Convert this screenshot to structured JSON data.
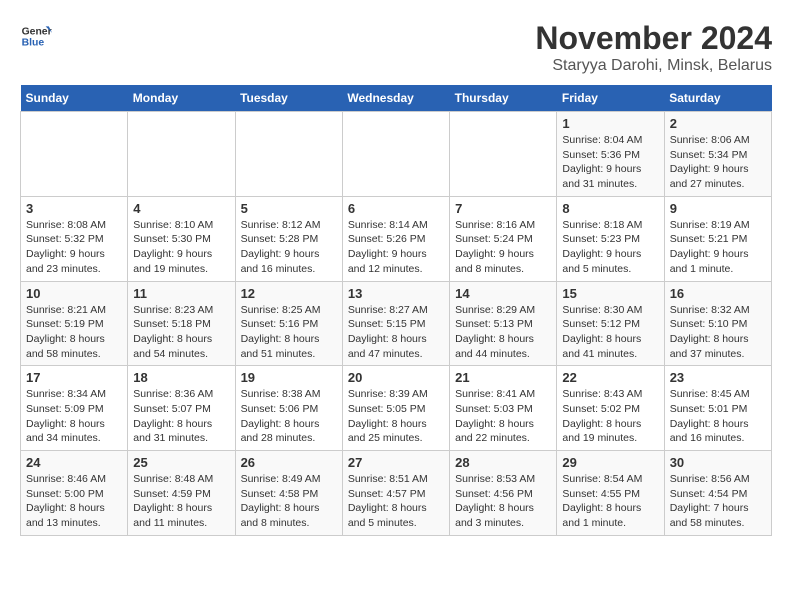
{
  "header": {
    "logo_line1": "General",
    "logo_line2": "Blue",
    "title": "November 2024",
    "subtitle": "Staryya Darohi, Minsk, Belarus"
  },
  "columns": [
    "Sunday",
    "Monday",
    "Tuesday",
    "Wednesday",
    "Thursday",
    "Friday",
    "Saturday"
  ],
  "weeks": [
    [
      {
        "day": "",
        "info": ""
      },
      {
        "day": "",
        "info": ""
      },
      {
        "day": "",
        "info": ""
      },
      {
        "day": "",
        "info": ""
      },
      {
        "day": "",
        "info": ""
      },
      {
        "day": "1",
        "info": "Sunrise: 8:04 AM\nSunset: 5:36 PM\nDaylight: 9 hours and 31 minutes."
      },
      {
        "day": "2",
        "info": "Sunrise: 8:06 AM\nSunset: 5:34 PM\nDaylight: 9 hours and 27 minutes."
      }
    ],
    [
      {
        "day": "3",
        "info": "Sunrise: 8:08 AM\nSunset: 5:32 PM\nDaylight: 9 hours and 23 minutes."
      },
      {
        "day": "4",
        "info": "Sunrise: 8:10 AM\nSunset: 5:30 PM\nDaylight: 9 hours and 19 minutes."
      },
      {
        "day": "5",
        "info": "Sunrise: 8:12 AM\nSunset: 5:28 PM\nDaylight: 9 hours and 16 minutes."
      },
      {
        "day": "6",
        "info": "Sunrise: 8:14 AM\nSunset: 5:26 PM\nDaylight: 9 hours and 12 minutes."
      },
      {
        "day": "7",
        "info": "Sunrise: 8:16 AM\nSunset: 5:24 PM\nDaylight: 9 hours and 8 minutes."
      },
      {
        "day": "8",
        "info": "Sunrise: 8:18 AM\nSunset: 5:23 PM\nDaylight: 9 hours and 5 minutes."
      },
      {
        "day": "9",
        "info": "Sunrise: 8:19 AM\nSunset: 5:21 PM\nDaylight: 9 hours and 1 minute."
      }
    ],
    [
      {
        "day": "10",
        "info": "Sunrise: 8:21 AM\nSunset: 5:19 PM\nDaylight: 8 hours and 58 minutes."
      },
      {
        "day": "11",
        "info": "Sunrise: 8:23 AM\nSunset: 5:18 PM\nDaylight: 8 hours and 54 minutes."
      },
      {
        "day": "12",
        "info": "Sunrise: 8:25 AM\nSunset: 5:16 PM\nDaylight: 8 hours and 51 minutes."
      },
      {
        "day": "13",
        "info": "Sunrise: 8:27 AM\nSunset: 5:15 PM\nDaylight: 8 hours and 47 minutes."
      },
      {
        "day": "14",
        "info": "Sunrise: 8:29 AM\nSunset: 5:13 PM\nDaylight: 8 hours and 44 minutes."
      },
      {
        "day": "15",
        "info": "Sunrise: 8:30 AM\nSunset: 5:12 PM\nDaylight: 8 hours and 41 minutes."
      },
      {
        "day": "16",
        "info": "Sunrise: 8:32 AM\nSunset: 5:10 PM\nDaylight: 8 hours and 37 minutes."
      }
    ],
    [
      {
        "day": "17",
        "info": "Sunrise: 8:34 AM\nSunset: 5:09 PM\nDaylight: 8 hours and 34 minutes."
      },
      {
        "day": "18",
        "info": "Sunrise: 8:36 AM\nSunset: 5:07 PM\nDaylight: 8 hours and 31 minutes."
      },
      {
        "day": "19",
        "info": "Sunrise: 8:38 AM\nSunset: 5:06 PM\nDaylight: 8 hours and 28 minutes."
      },
      {
        "day": "20",
        "info": "Sunrise: 8:39 AM\nSunset: 5:05 PM\nDaylight: 8 hours and 25 minutes."
      },
      {
        "day": "21",
        "info": "Sunrise: 8:41 AM\nSunset: 5:03 PM\nDaylight: 8 hours and 22 minutes."
      },
      {
        "day": "22",
        "info": "Sunrise: 8:43 AM\nSunset: 5:02 PM\nDaylight: 8 hours and 19 minutes."
      },
      {
        "day": "23",
        "info": "Sunrise: 8:45 AM\nSunset: 5:01 PM\nDaylight: 8 hours and 16 minutes."
      }
    ],
    [
      {
        "day": "24",
        "info": "Sunrise: 8:46 AM\nSunset: 5:00 PM\nDaylight: 8 hours and 13 minutes."
      },
      {
        "day": "25",
        "info": "Sunrise: 8:48 AM\nSunset: 4:59 PM\nDaylight: 8 hours and 11 minutes."
      },
      {
        "day": "26",
        "info": "Sunrise: 8:49 AM\nSunset: 4:58 PM\nDaylight: 8 hours and 8 minutes."
      },
      {
        "day": "27",
        "info": "Sunrise: 8:51 AM\nSunset: 4:57 PM\nDaylight: 8 hours and 5 minutes."
      },
      {
        "day": "28",
        "info": "Sunrise: 8:53 AM\nSunset: 4:56 PM\nDaylight: 8 hours and 3 minutes."
      },
      {
        "day": "29",
        "info": "Sunrise: 8:54 AM\nSunset: 4:55 PM\nDaylight: 8 hours and 1 minute."
      },
      {
        "day": "30",
        "info": "Sunrise: 8:56 AM\nSunset: 4:54 PM\nDaylight: 7 hours and 58 minutes."
      }
    ]
  ]
}
